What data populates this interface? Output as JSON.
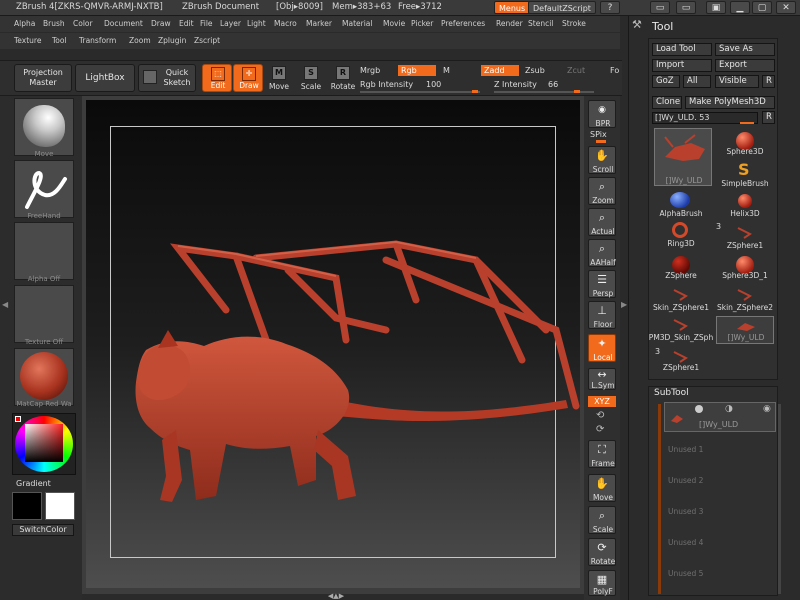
{
  "titlebar": {
    "app": "ZBrush 4[ZKRS-QMVR-ARMJ-NXTB]",
    "doc": "ZBrush Document",
    "obj": "[Obj▸8009]",
    "mem": "Mem▸383+63",
    "free": "Free▸3712",
    "menus_btn": "Menus",
    "script_btn": "DefaultZScript"
  },
  "menu_row1": [
    "Alpha",
    "Brush",
    "Color",
    "Document",
    "Draw",
    "Edit",
    "File",
    "Layer",
    "Light",
    "Macro",
    "Marker",
    "Material",
    "Movie",
    "Picker",
    "Preferences",
    "Render",
    "Stencil",
    "Stroke"
  ],
  "menu_row2": [
    "Texture",
    "Tool",
    "Transform",
    "Zoom",
    "Zplugin",
    "Zscript"
  ],
  "toolbar": {
    "projection_master": "Projection\nMaster",
    "lightbox": "LightBox",
    "quick_sketch": "Quick\nSketch",
    "edit": "Edit",
    "draw": "Draw",
    "move": "Move",
    "scale": "Scale",
    "rotate": "Rotate",
    "mrgb": "Mrgb",
    "rgb": "Rgb",
    "m": "M",
    "zadd": "Zadd",
    "zsub": "Zsub",
    "zcut": "Zcut",
    "fo": "Fo",
    "rgb_intensity_label": "Rgb Intensity",
    "rgb_intensity_value": "100",
    "z_intensity_label": "Z Intensity",
    "z_intensity_value": "66"
  },
  "leftshelf": {
    "brush_label": "Move",
    "stroke_label": "FreeHand",
    "alpha_label": "Alpha Off",
    "texture_label": "Texture Off",
    "material_label": "MatCap Red Wa",
    "gradient_label": "Gradient",
    "switchcolor_label": "SwitchColor"
  },
  "rightcol": {
    "bpr": "BPR",
    "spix": "SPix",
    "scroll": "Scroll",
    "zoom": "Zoom",
    "actual": "Actual",
    "aahalf": "AAHalf",
    "persp": "Persp",
    "floor": "Floor",
    "local": "Local",
    "lsym": "L.Sym",
    "xyz": "XYZ",
    "frame": "Frame",
    "move": "Move",
    "scale": "Scale",
    "rotate": "Rotate",
    "polyf": "PolyF"
  },
  "toolpanel": {
    "title": "Tool",
    "load_tool": "Load Tool",
    "save_as": "Save As",
    "import": "Import",
    "export": "Export",
    "goz": "GoZ",
    "all": "All",
    "visible": "Visible",
    "r": "R",
    "clone": "Clone",
    "make_polymesh": "Make PolyMesh3D",
    "current_tool": "[]Wy_ULD. 53",
    "r2": "R",
    "thumb_count_a": "3",
    "thumb_count_b": "3",
    "tools": [
      {
        "name": "[]Wy_ULD"
      },
      {
        "name": "Sphere3D"
      },
      {
        "name": "SimpleBrush"
      },
      {
        "name": "AlphaBrush"
      },
      {
        "name": "Helix3D"
      },
      {
        "name": "Ring3D"
      },
      {
        "name": "ZSphere1"
      },
      {
        "name": "ZSphere"
      },
      {
        "name": "Sphere3D_1"
      },
      {
        "name": "Skin_ZSphere1"
      },
      {
        "name": "Skin_ZSphere2"
      },
      {
        "name": "PM3D_Skin_ZSph"
      },
      {
        "name": "[]Wy_ULD"
      },
      {
        "name": "ZSphere1"
      }
    ],
    "subtool_title": "SubTool",
    "subtool_active": "[]Wy_ULD",
    "subtool_unused": [
      "Unused 1",
      "Unused 2",
      "Unused 3",
      "Unused 4",
      "Unused 5"
    ]
  },
  "colors": {
    "accent": "#f26a1b",
    "model": "#b8402c"
  }
}
